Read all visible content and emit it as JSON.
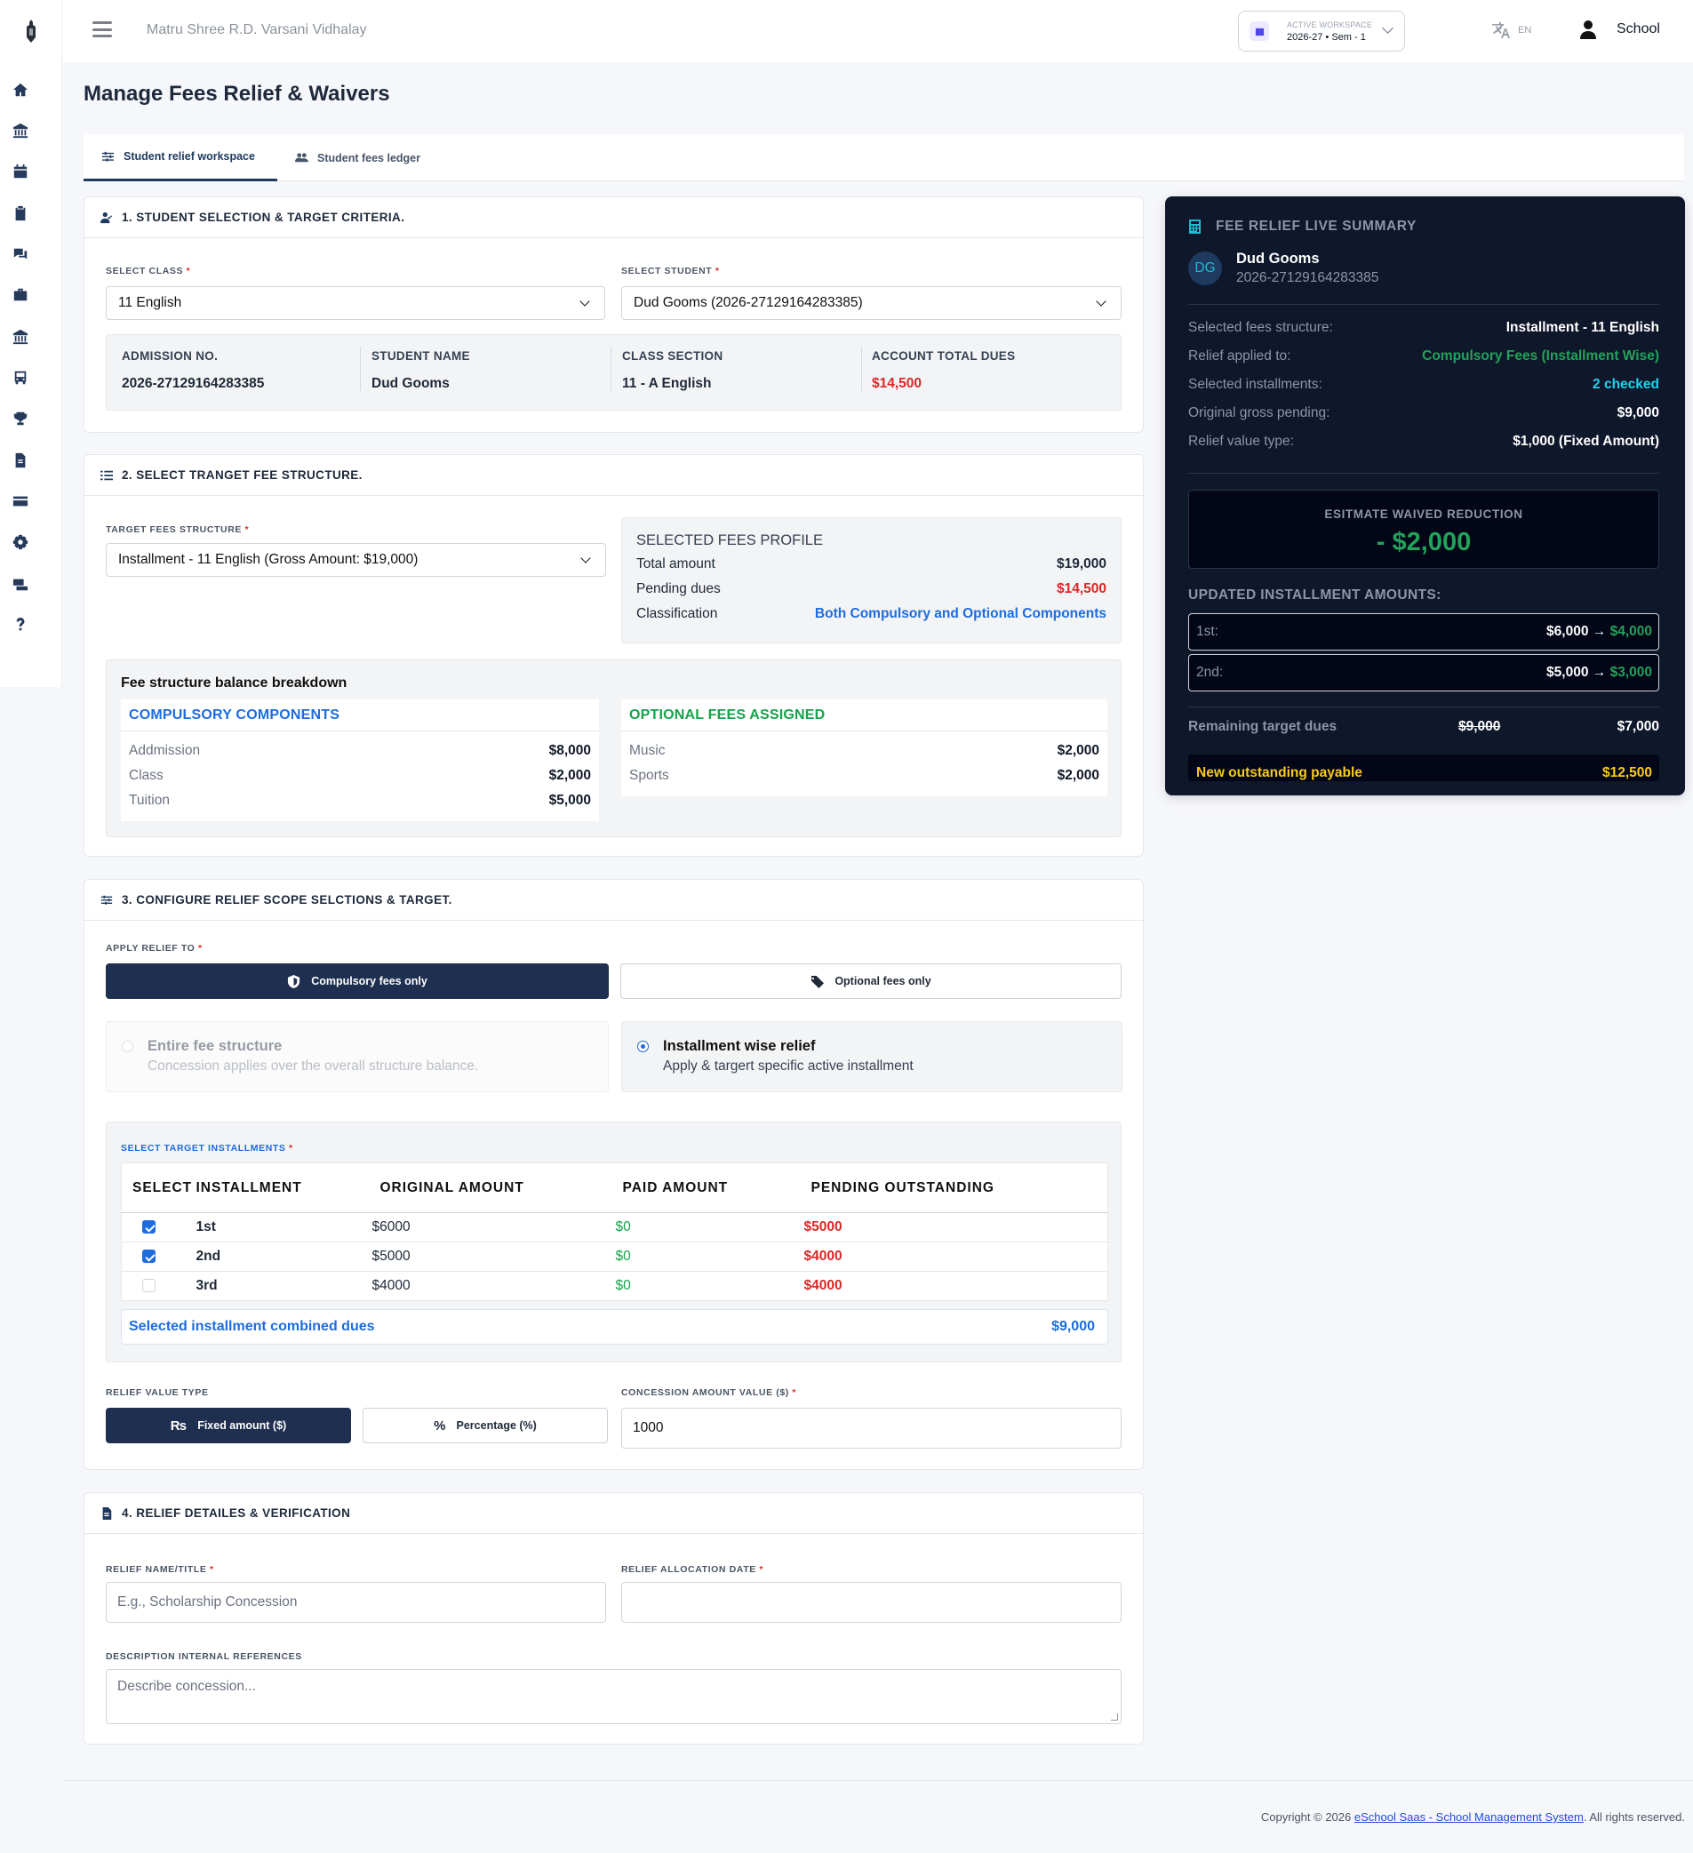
{
  "app": {
    "school_name": "Matru Shree R.D. Varsani Vidhalay"
  },
  "workspace": {
    "label": "ACTIVE WORKSPACE",
    "value": "2026-27 • Sem - 1"
  },
  "language": {
    "code": "EN"
  },
  "user": {
    "name": "School"
  },
  "sidebar": {
    "icons": [
      "home-icon",
      "bank-icon",
      "calendar-icon",
      "clipboard-icon",
      "chat-icon",
      "briefcase-icon",
      "institution-icon",
      "bus-icon",
      "trophy-icon",
      "document-icon",
      "card-icon",
      "gear-icon",
      "money-transfer-icon",
      "help-icon"
    ]
  },
  "page": {
    "title": "Manage Fees Relief & Waivers"
  },
  "tabs": [
    {
      "label": "Student relief workspace",
      "active": true
    },
    {
      "label": "Student fees ledger",
      "active": false
    }
  ],
  "section1": {
    "title": "1. STUDENT SELECTION & TARGET CRITERIA.",
    "class_label": "SELECT CLASS",
    "class_value": "11 English",
    "student_label": "SELECT STUDENT",
    "student_value": "Dud Gooms (2026-27129164283385)",
    "info": [
      {
        "label": "ADMISSION NO.",
        "value": "2026-27129164283385"
      },
      {
        "label": "STUDENT NAME",
        "value": "Dud Gooms"
      },
      {
        "label": "CLASS SECTION",
        "value": "11 - A English"
      },
      {
        "label": "ACCOUNT TOTAL DUES",
        "value": "$14,500"
      }
    ]
  },
  "section2": {
    "title": "2. SELECT TRANGET FEE STRUCTURE.",
    "structure_label": "TARGET FEES STRUCTURE",
    "structure_value": "Installment - 11 English (Gross Amount: $19,000)",
    "profile": {
      "title": "SELECTED FEES PROFILE",
      "rows": [
        {
          "label": "Total amount",
          "value": "$19,000"
        },
        {
          "label": "Pending dues",
          "value": "$14,500"
        },
        {
          "label": "Classification",
          "value": "Both Compulsory and Optional Components"
        }
      ]
    },
    "breakdown": {
      "title": "Fee structure balance breakdown",
      "compulsory_title": "COMPULSORY COMPONENTS",
      "compulsory": [
        {
          "name": "Addmission",
          "amount": "$8,000"
        },
        {
          "name": "Class",
          "amount": "$2,000"
        },
        {
          "name": "Tuition",
          "amount": "$5,000"
        }
      ],
      "optional_title": "OPTIONAL FEES ASSIGNED",
      "optional": [
        {
          "name": "Music",
          "amount": "$2,000"
        },
        {
          "name": "Sports",
          "amount": "$2,000"
        }
      ]
    }
  },
  "section3": {
    "title": "3. CONFIGURE RELIEF SCOPE SELCTIONS & TARGET.",
    "apply_label": "APPLY RELIEF TO",
    "compulsory_btn": "Compulsory fees only",
    "optional_btn": "Optional fees only",
    "entire": {
      "title": "Entire fee structure",
      "desc": "Concession applies over the overall structure balance."
    },
    "installment": {
      "title": "Installment wise relief",
      "desc": "Apply & targert specific active installment"
    },
    "inst_label": "SELECT TARGET INSTALLMENTS",
    "columns": [
      "SELECT",
      "INSTALLMENT",
      "ORIGINAL AMOUNT",
      "PAID AMOUNT",
      "PENDING OUTSTANDING"
    ],
    "rows": [
      {
        "checked": true,
        "name": "1st",
        "original": "$6000",
        "paid": "$0",
        "pending": "$5000"
      },
      {
        "checked": true,
        "name": "2nd",
        "original": "$5000",
        "paid": "$0",
        "pending": "$4000"
      },
      {
        "checked": false,
        "name": "3rd",
        "original": "$4000",
        "paid": "$0",
        "pending": "$4000"
      }
    ],
    "combined_label": "Selected installment combined dues",
    "combined_value": "$9,000",
    "value_type_label": "RELIEF VALUE TYPE",
    "fixed_btn": "Fixed amount ($)",
    "percent_btn": "Percentage (%)",
    "concession_label": "CONCESSION AMOUNT VALUE ($)",
    "concession_value": "1000"
  },
  "section4": {
    "title": "4. RELIEF DETAILES & VERIFICATION",
    "name_label": "RELIEF NAME/TITLE",
    "name_placeholder": "E.g., Scholarship Concession",
    "date_label": "RELIEF ALLOCATION DATE",
    "desc_label": "DESCRIPTION INTERNAL REFERENCES",
    "desc_placeholder": "Describe concession..."
  },
  "summary": {
    "title": "FEE RELIEF LIVE SUMMARY",
    "initials": "DG",
    "student_name": "Dud Gooms",
    "student_id": "2026-27129164283385",
    "rows": [
      {
        "label": "Selected fees structure:",
        "value": "Installment - 11 English"
      },
      {
        "label": "Relief applied to:",
        "value": "Compulsory Fees (Installment Wise)"
      },
      {
        "label": "Selected installments:",
        "value": "2 checked"
      },
      {
        "label": "Original gross pending:",
        "value": "$9,000"
      },
      {
        "label": "Relief value type:",
        "value": "$1,000 (Fixed Amount)"
      }
    ],
    "estimate_label": "ESITMATE WAIVED REDUCTION",
    "estimate_value": "- $2,000",
    "updated_label": "UPDATED INSTALLMENT AMOUNTS:",
    "installments": [
      {
        "label": "1st:",
        "from": "$6,000",
        "arrow": "→",
        "to": "$4,000"
      },
      {
        "label": "2nd:",
        "from": "$5,000",
        "arrow": "→",
        "to": "$3,000"
      }
    ],
    "remaining_label": "Remaining target dues",
    "remaining_old": "$9,000",
    "remaining_new": "$7,000",
    "new_payable_label": "New outstanding payable",
    "new_payable_value": "$12,500"
  },
  "footer": {
    "prefix": "Copyright © 2026 ",
    "link": "eSchool Saas - School Management System",
    "suffix": ". All rights reserved."
  },
  "colors": {
    "primary": "#1e2f4f",
    "accent_blue": "#1d6ce0",
    "danger": "#dc2626",
    "success": "#16a34a",
    "summary_bg": "#0f172a"
  }
}
